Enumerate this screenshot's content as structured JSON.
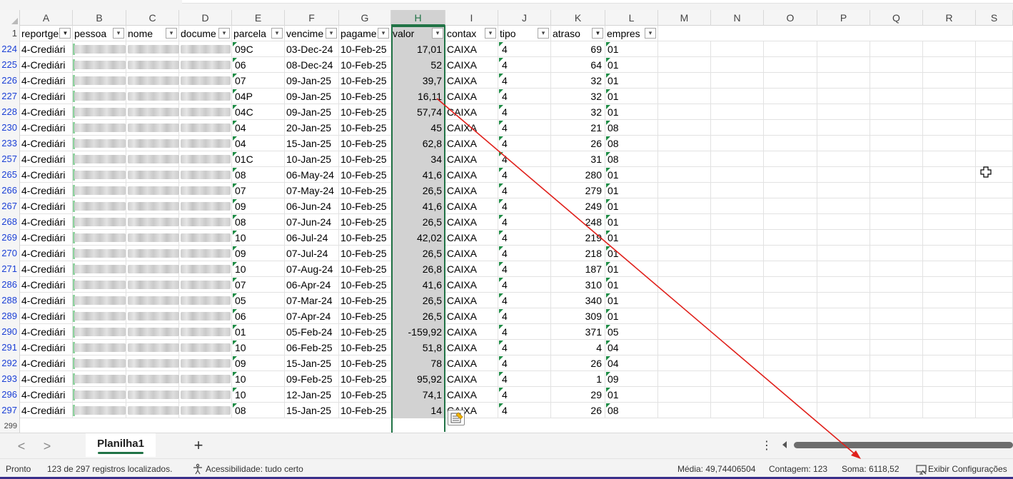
{
  "columns": [
    "A",
    "B",
    "C",
    "D",
    "E",
    "F",
    "G",
    "H",
    "I",
    "J",
    "K",
    "L",
    "M",
    "N",
    "O",
    "P",
    "Q",
    "R",
    "S"
  ],
  "selected_column": "H",
  "header_row": {
    "row_number": "1",
    "fields": [
      "reportge",
      "pessoa",
      "nome",
      "docume",
      "parcela",
      "vencime",
      "pagame",
      "valor",
      "contax",
      "tipo",
      "atraso",
      "empres"
    ],
    "filter_active": [
      "reportge",
      "atraso"
    ]
  },
  "rows": [
    {
      "n": "224",
      "report": "4-Crediári",
      "parcela": "09C",
      "venc": "03-Dec-24",
      "pag": "10-Feb-25",
      "valor": "17,01",
      "conta": "CAIXA",
      "tipo": "4",
      "atraso": "69",
      "emp": "01"
    },
    {
      "n": "225",
      "report": "4-Crediári",
      "parcela": "06",
      "venc": "08-Dec-24",
      "pag": "10-Feb-25",
      "valor": "52",
      "conta": "CAIXA",
      "tipo": "4",
      "atraso": "64",
      "emp": "01"
    },
    {
      "n": "226",
      "report": "4-Crediári",
      "parcela": "07",
      "venc": "09-Jan-25",
      "pag": "10-Feb-25",
      "valor": "39,7",
      "conta": "CAIXA",
      "tipo": "4",
      "atraso": "32",
      "emp": "01"
    },
    {
      "n": "227",
      "report": "4-Crediári",
      "parcela": "04P",
      "venc": "09-Jan-25",
      "pag": "10-Feb-25",
      "valor": "16,11",
      "conta": "CAIXA",
      "tipo": "4",
      "atraso": "32",
      "emp": "01"
    },
    {
      "n": "228",
      "report": "4-Crediári",
      "parcela": "04C",
      "venc": "09-Jan-25",
      "pag": "10-Feb-25",
      "valor": "57,74",
      "conta": "CAIXA",
      "tipo": "4",
      "atraso": "32",
      "emp": "01"
    },
    {
      "n": "230",
      "report": "4-Crediári",
      "parcela": "04",
      "venc": "20-Jan-25",
      "pag": "10-Feb-25",
      "valor": "45",
      "conta": "CAIXA",
      "tipo": "4",
      "atraso": "21",
      "emp": "08"
    },
    {
      "n": "233",
      "report": "4-Crediári",
      "parcela": "04",
      "venc": "15-Jan-25",
      "pag": "10-Feb-25",
      "valor": "62,8",
      "conta": "CAIXA",
      "tipo": "4",
      "atraso": "26",
      "emp": "08"
    },
    {
      "n": "257",
      "report": "4-Crediári",
      "parcela": "01C",
      "venc": "10-Jan-25",
      "pag": "10-Feb-25",
      "valor": "34",
      "conta": "CAIXA",
      "tipo": "4",
      "atraso": "31",
      "emp": "08"
    },
    {
      "n": "265",
      "report": "4-Crediári",
      "parcela": "08",
      "venc": "06-May-24",
      "pag": "10-Feb-25",
      "valor": "41,6",
      "conta": "CAIXA",
      "tipo": "4",
      "atraso": "280",
      "emp": "01"
    },
    {
      "n": "266",
      "report": "4-Crediári",
      "parcela": "07",
      "venc": "07-May-24",
      "pag": "10-Feb-25",
      "valor": "26,5",
      "conta": "CAIXA",
      "tipo": "4",
      "atraso": "279",
      "emp": "01"
    },
    {
      "n": "267",
      "report": "4-Crediári",
      "parcela": "09",
      "venc": "06-Jun-24",
      "pag": "10-Feb-25",
      "valor": "41,6",
      "conta": "CAIXA",
      "tipo": "4",
      "atraso": "249",
      "emp": "01"
    },
    {
      "n": "268",
      "report": "4-Crediári",
      "parcela": "08",
      "venc": "07-Jun-24",
      "pag": "10-Feb-25",
      "valor": "26,5",
      "conta": "CAIXA",
      "tipo": "4",
      "atraso": "248",
      "emp": "01"
    },
    {
      "n": "269",
      "report": "4-Crediári",
      "parcela": "10",
      "venc": "06-Jul-24",
      "pag": "10-Feb-25",
      "valor": "42,02",
      "conta": "CAIXA",
      "tipo": "4",
      "atraso": "219",
      "emp": "01"
    },
    {
      "n": "270",
      "report": "4-Crediári",
      "parcela": "09",
      "venc": "07-Jul-24",
      "pag": "10-Feb-25",
      "valor": "26,5",
      "conta": "CAIXA",
      "tipo": "4",
      "atraso": "218",
      "emp": "01"
    },
    {
      "n": "271",
      "report": "4-Crediári",
      "parcela": "10",
      "venc": "07-Aug-24",
      "pag": "10-Feb-25",
      "valor": "26,8",
      "conta": "CAIXA",
      "tipo": "4",
      "atraso": "187",
      "emp": "01"
    },
    {
      "n": "286",
      "report": "4-Crediári",
      "parcela": "07",
      "venc": "06-Apr-24",
      "pag": "10-Feb-25",
      "valor": "41,6",
      "conta": "CAIXA",
      "tipo": "4",
      "atraso": "310",
      "emp": "01"
    },
    {
      "n": "288",
      "report": "4-Crediári",
      "parcela": "05",
      "venc": "07-Mar-24",
      "pag": "10-Feb-25",
      "valor": "26,5",
      "conta": "CAIXA",
      "tipo": "4",
      "atraso": "340",
      "emp": "01"
    },
    {
      "n": "289",
      "report": "4-Crediári",
      "parcela": "06",
      "venc": "07-Apr-24",
      "pag": "10-Feb-25",
      "valor": "26,5",
      "conta": "CAIXA",
      "tipo": "4",
      "atraso": "309",
      "emp": "01"
    },
    {
      "n": "290",
      "report": "4-Crediári",
      "parcela": "01",
      "venc": "05-Feb-24",
      "pag": "10-Feb-25",
      "valor": "-159,92",
      "conta": "CAIXA",
      "tipo": "4",
      "atraso": "371",
      "emp": "05"
    },
    {
      "n": "291",
      "report": "4-Crediári",
      "parcela": "10",
      "venc": "06-Feb-25",
      "pag": "10-Feb-25",
      "valor": "51,8",
      "conta": "CAIXA",
      "tipo": "4",
      "atraso": "4",
      "emp": "04"
    },
    {
      "n": "292",
      "report": "4-Crediári",
      "parcela": "09",
      "venc": "15-Jan-25",
      "pag": "10-Feb-25",
      "valor": "78",
      "conta": "CAIXA",
      "tipo": "4",
      "atraso": "26",
      "emp": "04"
    },
    {
      "n": "293",
      "report": "4-Crediári",
      "parcela": "10",
      "venc": "09-Feb-25",
      "pag": "10-Feb-25",
      "valor": "95,92",
      "conta": "CAIXA",
      "tipo": "4",
      "atraso": "1",
      "emp": "09"
    },
    {
      "n": "296",
      "report": "4-Crediári",
      "parcela": "10",
      "venc": "12-Jan-25",
      "pag": "10-Feb-25",
      "valor": "74,1",
      "conta": "CAIXA",
      "tipo": "4",
      "atraso": "29",
      "emp": "01"
    },
    {
      "n": "297",
      "report": "4-Crediári",
      "parcela": "08",
      "venc": "15-Jan-25",
      "pag": "10-Feb-25",
      "valor": "14",
      "conta": "CAIXA",
      "tipo": "4",
      "atraso": "26",
      "emp": "08"
    }
  ],
  "next_row_number": "299",
  "sheet_tabs": {
    "prev_label": "<",
    "next_label": ">",
    "active": "Planilha1",
    "add_label": "+",
    "more_label": "⋮"
  },
  "status_bar": {
    "mode": "Pronto",
    "filter_info": "123 de 297 registros localizados.",
    "accessibility": "Acessibilidade: tudo certo",
    "average": "Média: 49,74406504",
    "count": "Contagem: 123",
    "sum": "Soma: 6118,52",
    "settings": "Exibir Configurações"
  },
  "colors": {
    "accent_green": "#217346",
    "row_number_blue": "#1a3fd6",
    "annotation_red": "#e0201b"
  },
  "icons": [
    "filter-dropdown-icon",
    "filter-active-icon",
    "quick-analysis-icon",
    "move-cursor-icon",
    "accessibility-icon",
    "display-settings-icon"
  ]
}
